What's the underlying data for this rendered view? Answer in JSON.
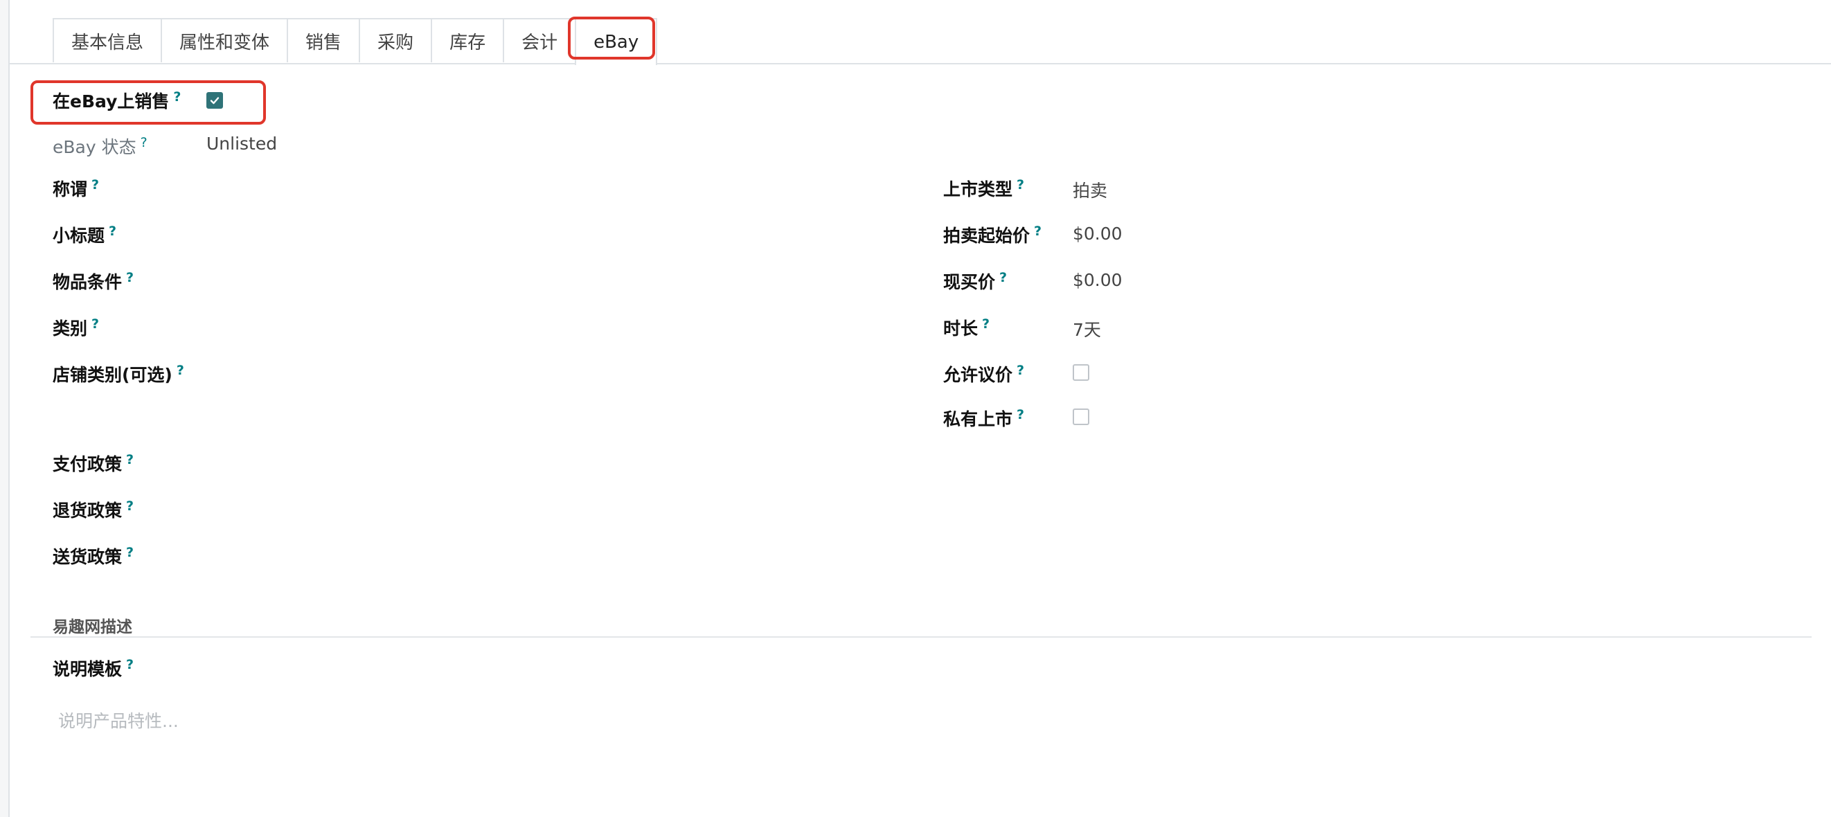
{
  "tabs": [
    "基本信息",
    "属性和变体",
    "销售",
    "采购",
    "库存",
    "会计",
    "eBay"
  ],
  "help_mark": "?",
  "sell_on_ebay": {
    "label": "在eBay上销售",
    "checked": true
  },
  "ebay_status": {
    "label": "eBay 状态",
    "value": "Unlisted"
  },
  "left_fields": {
    "title": "称谓",
    "subtitle": "小标题",
    "condition": "物品条件",
    "category": "类别",
    "store_category": "店铺类别(可选)",
    "payment_policy": "支付政策",
    "return_policy": "退货政策",
    "shipping_policy": "送货政策"
  },
  "right_fields": {
    "listing_type": {
      "label": "上市类型",
      "value": "拍卖"
    },
    "start_price": {
      "label": "拍卖起始价",
      "value": "$0.00"
    },
    "buy_now_price": {
      "label": "现买价",
      "value": "$0.00"
    },
    "duration": {
      "label": "时长",
      "value": "7天"
    },
    "best_offer": {
      "label": "允许议价",
      "checked": false
    },
    "private_listing": {
      "label": "私有上市",
      "checked": false
    }
  },
  "description_section": {
    "title": "易趣网描述",
    "template_label": "说明模板",
    "placeholder": "说明产品特性..."
  },
  "colors": {
    "highlight": "#e0362b",
    "checkbox_checked": "#2f7378",
    "help": "#017e84"
  }
}
